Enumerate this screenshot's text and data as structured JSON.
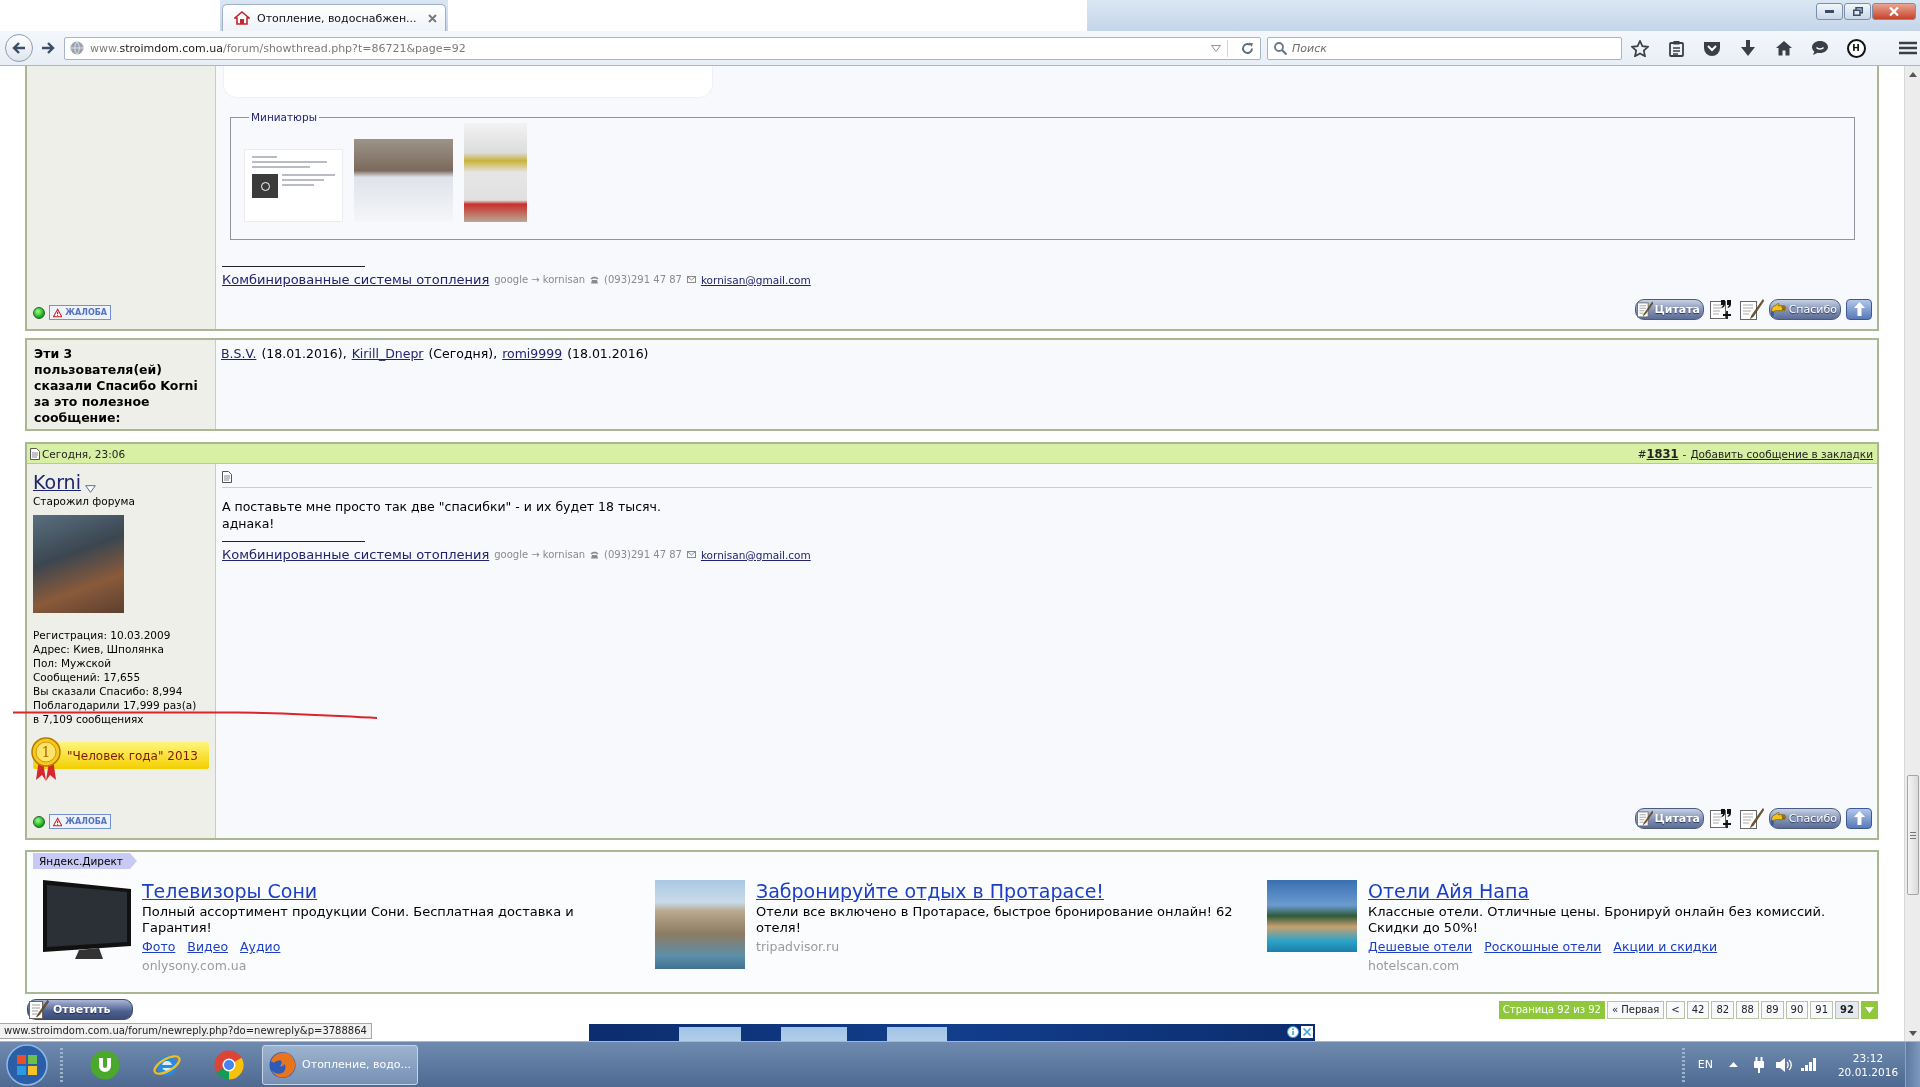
{
  "browser": {
    "tab": {
      "title": "Отопление, водоснабжен...",
      "selected": true
    },
    "url": {
      "prefix": "www.",
      "host": "stroimdom.com.ua",
      "path": "/forum/showthread.php?t=86721&page=92"
    },
    "search": {
      "placeholder": "Поиск"
    },
    "toolbar": [
      {
        "kind": "star"
      },
      {
        "kind": "clipboard"
      },
      {
        "kind": "pocket"
      },
      {
        "kind": "download"
      },
      {
        "kind": "home"
      },
      {
        "kind": "chat"
      },
      {
        "kind": "addon",
        "label": "H"
      },
      {
        "kind": "menu"
      }
    ]
  },
  "post_top": {
    "thumbnails_legend": "Миниатюры",
    "thumbnails": [
      {
        "kind": "screenshot"
      },
      {
        "kind": "landscape"
      },
      {
        "kind": "portrait"
      }
    ],
    "signature": {
      "link": "Комбинированные системы отопления",
      "contact": "google → kornisan",
      "phone": "(093)291 47 87",
      "email": "kornisan@gmail.com"
    },
    "online": true,
    "report": "ЖАЛОБА",
    "actions": [
      {
        "kind": "quote",
        "label": "Цитата"
      },
      {
        "kind": "multiquote"
      },
      {
        "kind": "edit"
      },
      {
        "kind": "thanks",
        "label": "Спасибо"
      },
      {
        "kind": "top"
      }
    ]
  },
  "thanks": {
    "title": "Эти 3 пользователя(ей) сказали Спасибо Korni за это полезное сообщение:",
    "users": [
      {
        "name": "B.S.V.",
        "note": "(18.01.2016),"
      },
      {
        "name": "Kirill_Dnepr",
        "note": "(Сегодня),"
      },
      {
        "name": "romi9999",
        "note": "(18.01.2016)"
      }
    ]
  },
  "post": {
    "date": "Сегодня, 23:06",
    "number": "#**1831**",
    "separator": "-",
    "bookmark": "Добавить сообщение в закладки",
    "user": {
      "name": "Korni",
      "title": "Старожил форума",
      "stats": [
        "Регистрация: 10.03.2009",
        "Адрес: Киев, Шполянка",
        "Пол: Мужской",
        "Сообщений: 17,655",
        "Вы сказали Спасибо: 8,994",
        "Поблагодарили 17,999 раз(а)",
        "в 7,109 сообщениях"
      ],
      "award": {
        "medal_number": "1",
        "title": "\"Человек года\" 2013"
      },
      "online": true,
      "report": "ЖАЛОБА"
    },
    "message": [
      "А поставьте мне просто так две \"спасибки\" - и их будет 18 тысяч.",
      "аднака!"
    ],
    "signature": {
      "link": "Комбинированные системы отопления",
      "contact": "google → kornisan",
      "phone": "(093)291 47 87",
      "email": "kornisan@gmail.com"
    },
    "actions": [
      {
        "kind": "quote",
        "label": "Цитата"
      },
      {
        "kind": "multiquote"
      },
      {
        "kind": "edit"
      },
      {
        "kind": "thanks",
        "label": "Спасибо"
      },
      {
        "kind": "top"
      }
    ]
  },
  "yandex_direct": {
    "label": "Яндекс.Директ",
    "ads": [
      {
        "kind": "tv",
        "title": "Телевизоры Сони",
        "text": "Полный ассортимент продукции Сони. Бесплатная доставка и Гарантия!",
        "links": [
          "Фото",
          "Видео",
          "Аудио"
        ],
        "domain": "onlysony.com.ua"
      },
      {
        "kind": "coast",
        "title": "Забронируйте отдых в Протарасе!",
        "text": "Отели все включено в Протарасе, быстрое бронирование онлайн! 62 отеля!",
        "domain": "tripadvisor.ru"
      },
      {
        "kind": "resort",
        "title": "Отели Айя Напа",
        "text": "Классные отели. Отличные цены. Бронируй онлайн без комиссий. Скидки до 50%!",
        "links": [
          "Дешевые отели",
          "Роскошные отели",
          "Акции и скидки"
        ],
        "domain": "hotelscan.com"
      }
    ]
  },
  "reply_button": "Ответить",
  "pagination": {
    "label": "Страница 92 из 92",
    "first": "« Первая",
    "prev": "<",
    "pages": [
      {
        "label": "42",
        "selected": false
      },
      {
        "label": "82",
        "selected": false
      },
      {
        "label": "88",
        "selected": false
      },
      {
        "label": "89",
        "selected": false
      },
      {
        "label": "90",
        "selected": false
      },
      {
        "label": "91",
        "selected": false
      },
      {
        "label": "92",
        "selected": true
      }
    ]
  },
  "status_url": "www.stroimdom.com.ua/forum/newreply.php?do=newreply&p=3788864",
  "taskbar": {
    "items": [
      {
        "kind": "utorrent",
        "selected": false
      },
      {
        "kind": "ie",
        "selected": false
      },
      {
        "kind": "chrome",
        "selected": false
      },
      {
        "kind": "firefox",
        "label": "Отопление, водо...",
        "selected": true
      }
    ],
    "language": "EN",
    "time": "23:12",
    "date": "20.01.2016"
  }
}
